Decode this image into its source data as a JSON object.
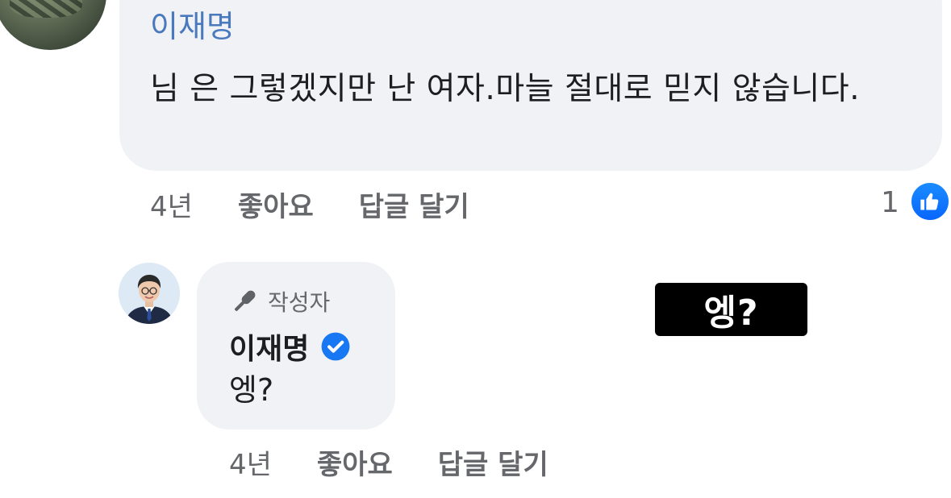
{
  "comment": {
    "author": "이재명",
    "text": "님 은 그렇겠지만 난 여자.마늘 절대로 믿지 않습니다.",
    "age": "4년",
    "like_label": "좋아요",
    "reply_label": "답글 달기",
    "reaction_count": "1",
    "reaction_icon": "thumbs-up-icon"
  },
  "reply": {
    "badge_label": "작성자",
    "badge_icon": "microphone-icon",
    "author": "이재명",
    "verified_icon": "verified-check-icon",
    "text": "엥?",
    "age": "4년",
    "like_label": "좋아요",
    "reply_label": "답글 달기"
  },
  "caption": {
    "text": "엥?"
  },
  "colors": {
    "bubble_bg": "#f0f2f5",
    "author_link": "#4a79bd",
    "meta_text": "#65676b",
    "body_text": "#1c1e21",
    "like_blue": "#0866ff",
    "verified_blue": "#1877f2"
  }
}
